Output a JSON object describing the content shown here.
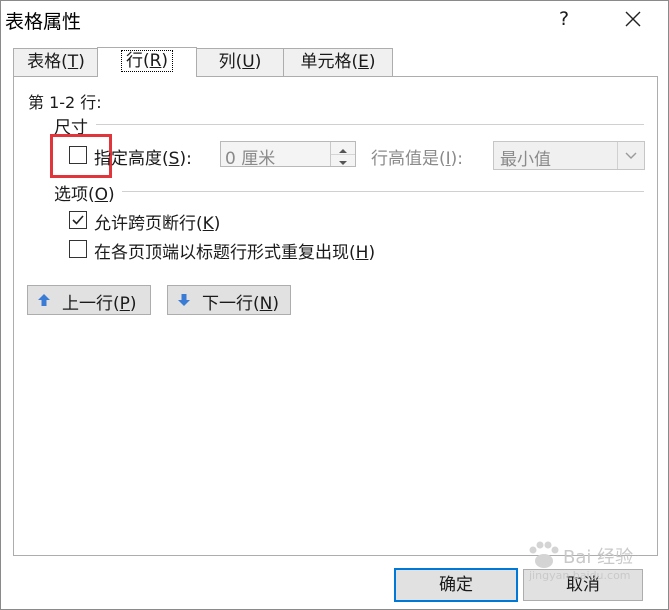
{
  "window": {
    "title": "表格属性",
    "help_label": "?"
  },
  "tabs": [
    {
      "label": "表格",
      "key": "T",
      "pre": "(",
      "post": ")",
      "active": false
    },
    {
      "label": "行",
      "key": "R",
      "pre": "(",
      "post": ")",
      "active": true
    },
    {
      "label": "列",
      "key": "U",
      "pre": "(",
      "post": ")",
      "active": false
    },
    {
      "label": "单元格",
      "key": "E",
      "pre": "(",
      "post": ")",
      "active": false
    }
  ],
  "panel": {
    "row_info": "第 1-2 行:",
    "size": {
      "section_label": "尺寸",
      "specify_height": {
        "label": "指定高度",
        "key": "S",
        "suffix": "):",
        "checked": false
      },
      "height_value": "0 厘米",
      "row_height_is": {
        "label": "行高值是",
        "key": "I",
        "suffix": "):"
      },
      "row_height_mode": "最小值"
    },
    "options": {
      "section_label": "选项",
      "key": "O",
      "allow_break": {
        "label": "允许跨页断行",
        "key": "K",
        "checked": true
      },
      "repeat_header": {
        "label": "在各页顶端以标题行形式重复出现",
        "key": "H",
        "checked": false
      }
    },
    "prev_row": {
      "label": "上一行",
      "key": "P"
    },
    "next_row": {
      "label": "下一行",
      "key": "N"
    }
  },
  "footer": {
    "ok_label": "确定",
    "cancel_label": "取消"
  },
  "watermark": {
    "main": "Bai 经验",
    "sub": "jingyan.baidu.com"
  },
  "colors": {
    "highlight": "#e0353a",
    "primary_border": "#0078d7",
    "arrow_blue": "#3a7bd5"
  }
}
